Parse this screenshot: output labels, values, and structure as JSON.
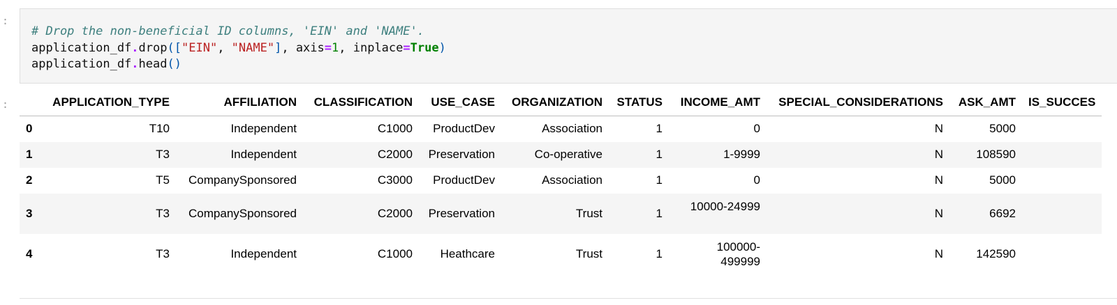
{
  "cell_in": {
    "prompt": "]:",
    "code": {
      "comment": "# Drop the non-beneficial ID columns, 'EIN' and 'NAME'.",
      "line2": {
        "obj": "application_df",
        "dot": ".",
        "method": "drop",
        "open_paren": "(",
        "open_bracket": "[",
        "str1": "\"EIN\"",
        "comma": ", ",
        "str2": "\"NAME\"",
        "close_bracket": "]",
        "sep": ", axis",
        "eq": "=",
        "num": "1",
        "sep2": ", inplace",
        "kw": "True",
        "close_paren": ")"
      },
      "line3": {
        "obj": "application_df",
        "dot": ".",
        "method": "head",
        "parens": "()"
      }
    }
  },
  "cell_out": {
    "prompt": "]:",
    "columns": [
      "APPLICATION_TYPE",
      "AFFILIATION",
      "CLASSIFICATION",
      "USE_CASE",
      "ORGANIZATION",
      "STATUS",
      "INCOME_AMT",
      "SPECIAL_CONSIDERATIONS",
      "ASK_AMT",
      "IS_SUCCES"
    ],
    "rows": [
      {
        "index": "0",
        "APPLICATION_TYPE": "T10",
        "AFFILIATION": "Independent",
        "CLASSIFICATION": "C1000",
        "USE_CASE": "ProductDev",
        "ORGANIZATION": "Association",
        "STATUS": "1",
        "INCOME_AMT": "0",
        "SPECIAL_CONSIDERATIONS": "N",
        "ASK_AMT": "5000",
        "IS_SUCCES": ""
      },
      {
        "index": "1",
        "APPLICATION_TYPE": "T3",
        "AFFILIATION": "Independent",
        "CLASSIFICATION": "C2000",
        "USE_CASE": "Preservation",
        "ORGANIZATION": "Co-operative",
        "STATUS": "1",
        "INCOME_AMT": "1-9999",
        "SPECIAL_CONSIDERATIONS": "N",
        "ASK_AMT": "108590",
        "IS_SUCCES": ""
      },
      {
        "index": "2",
        "APPLICATION_TYPE": "T5",
        "AFFILIATION": "CompanySponsored",
        "CLASSIFICATION": "C3000",
        "USE_CASE": "ProductDev",
        "ORGANIZATION": "Association",
        "STATUS": "1",
        "INCOME_AMT": "0",
        "SPECIAL_CONSIDERATIONS": "N",
        "ASK_AMT": "5000",
        "IS_SUCCES": ""
      },
      {
        "index": "3",
        "APPLICATION_TYPE": "T3",
        "AFFILIATION": "CompanySponsored",
        "CLASSIFICATION": "C2000",
        "USE_CASE": "Preservation",
        "ORGANIZATION": "Trust",
        "STATUS": "1",
        "INCOME_AMT": "10000-24999",
        "SPECIAL_CONSIDERATIONS": "N",
        "ASK_AMT": "6692",
        "IS_SUCCES": ""
      },
      {
        "index": "4",
        "APPLICATION_TYPE": "T3",
        "AFFILIATION": "Independent",
        "CLASSIFICATION": "C1000",
        "USE_CASE": "Heathcare",
        "ORGANIZATION": "Trust",
        "STATUS": "1",
        "INCOME_AMT": "100000-499999",
        "SPECIAL_CONSIDERATIONS": "N",
        "ASK_AMT": "142590",
        "IS_SUCCES": ""
      }
    ]
  }
}
